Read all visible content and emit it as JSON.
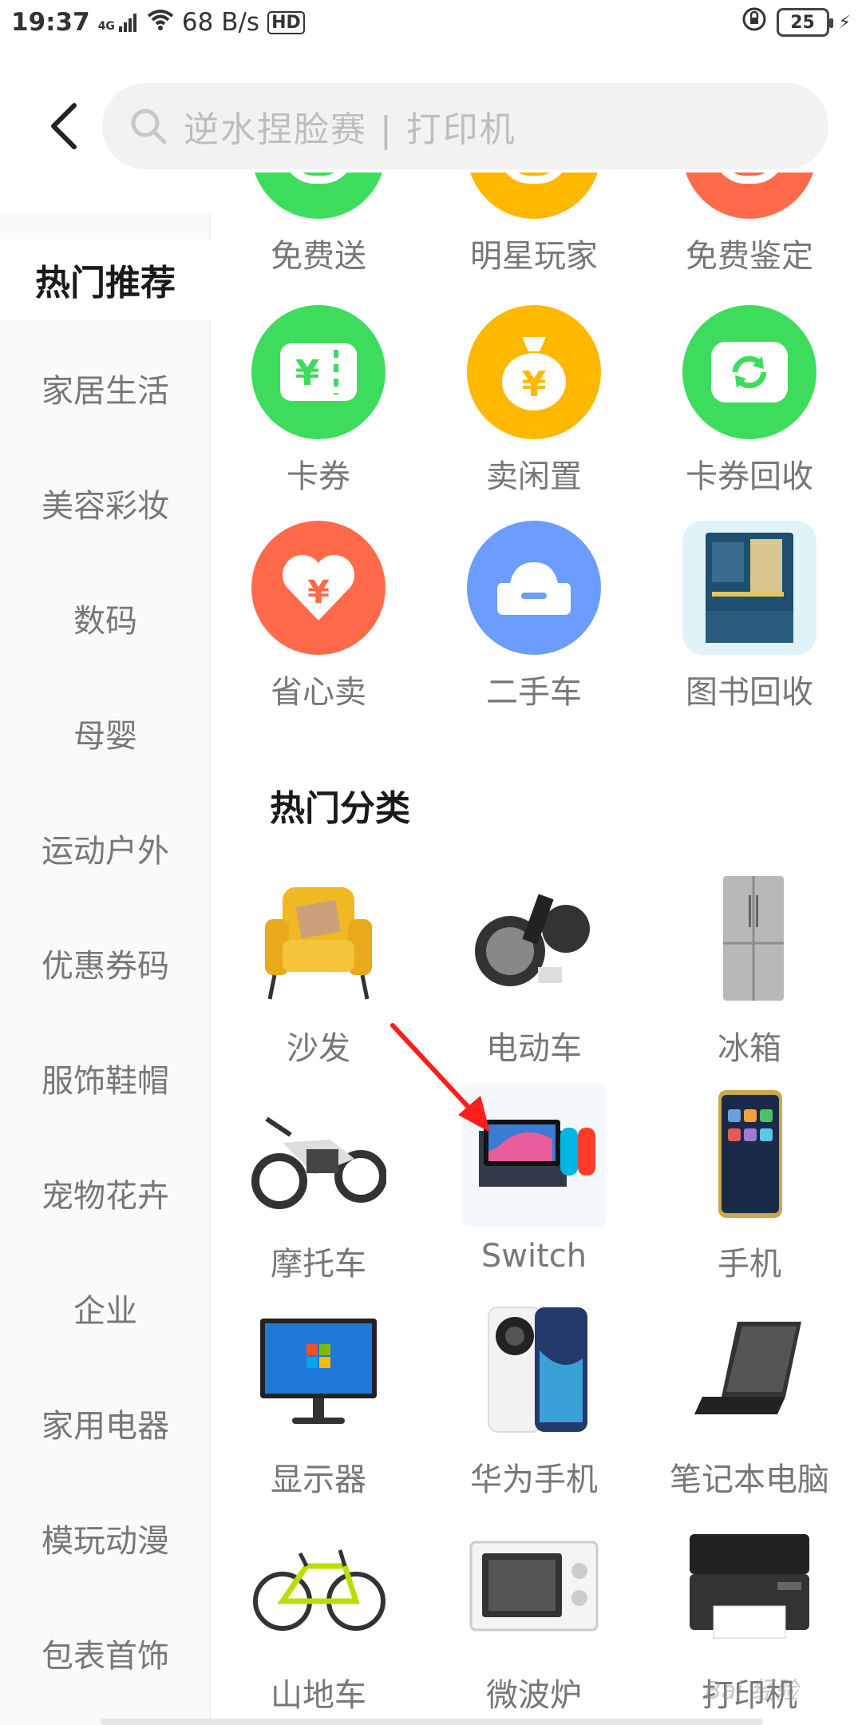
{
  "status": {
    "time": "19:37",
    "network": "4G",
    "speed": "68 B/s",
    "hd": "HD",
    "battery": "25"
  },
  "search": {
    "placeholder": "逆水捏脸赛 | 打印机"
  },
  "sidebar": {
    "items": [
      {
        "label": "热门推荐"
      },
      {
        "label": "家居生活"
      },
      {
        "label": "美容彩妆"
      },
      {
        "label": "数码"
      },
      {
        "label": "母婴"
      },
      {
        "label": "运动户外"
      },
      {
        "label": "优惠券码"
      },
      {
        "label": "服饰鞋帽"
      },
      {
        "label": "宠物花卉"
      },
      {
        "label": "企业"
      },
      {
        "label": "家用电器"
      },
      {
        "label": "模玩动漫"
      },
      {
        "label": "包表首饰"
      }
    ]
  },
  "services": {
    "row0": [
      {
        "label": "免费送",
        "color": "#3ddc5c"
      },
      {
        "label": "明星玩家",
        "color": "#ffb800"
      },
      {
        "label": "免费鉴定",
        "color": "#ff6b4a"
      }
    ],
    "row1": [
      {
        "label": "卡券",
        "color": "#3ddc5c"
      },
      {
        "label": "卖闲置",
        "color": "#ffb800"
      },
      {
        "label": "卡券回收",
        "color": "#3ddc5c"
      }
    ],
    "row2": [
      {
        "label": "省心卖",
        "color": "#ff6b4a"
      },
      {
        "label": "二手车",
        "color": "#6b9cff"
      },
      {
        "label": "图书回收"
      }
    ]
  },
  "hot_categories": {
    "title": "热门分类",
    "items": [
      {
        "label": "沙发"
      },
      {
        "label": "电动车"
      },
      {
        "label": "冰箱"
      },
      {
        "label": "摩托车"
      },
      {
        "label": "Switch"
      },
      {
        "label": "手机"
      },
      {
        "label": "显示器"
      },
      {
        "label": "华为手机"
      },
      {
        "label": "笔记本电脑"
      },
      {
        "label": "山地车"
      },
      {
        "label": "微波炉"
      },
      {
        "label": "打印机"
      }
    ]
  },
  "watermark": "Bai 经验"
}
